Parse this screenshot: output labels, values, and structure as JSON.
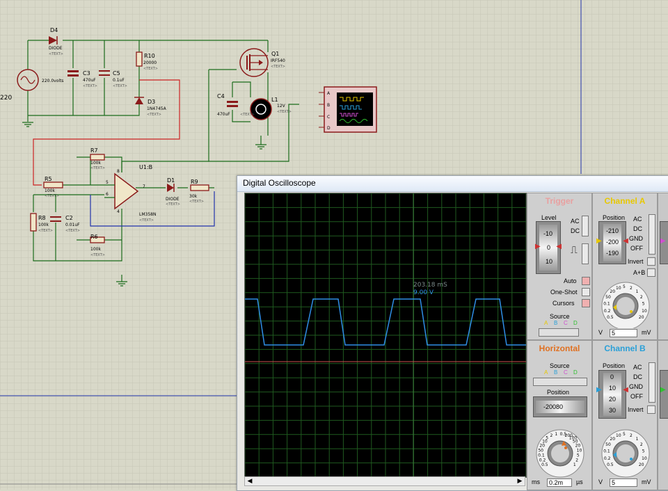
{
  "colors": {
    "background": "#d8d8c8",
    "grid": "#c6c6b6",
    "wire": "#1a6b1a",
    "component": "#8b1a1a",
    "selected_wire": "#cc2222",
    "blue_wire": "#2233aa",
    "trace_a": "#2f8ee6",
    "trace_b": "#d05050",
    "scope_grid": "#1f5a1f",
    "trigger": "#e8a0a0",
    "channel_a": "#e8c800",
    "horizontal": "#e07020",
    "channel_b": "#2aa0d8"
  },
  "schematic": {
    "components": {
      "d4": {
        "ref": "D4",
        "value": "DIODE"
      },
      "source": {
        "value": "220"
      },
      "cap_top": {
        "value": "220.0volts"
      },
      "c3": {
        "ref": "C3",
        "value": "470uF"
      },
      "c5": {
        "ref": "C5",
        "value": "0.1uF"
      },
      "r10": {
        "ref": "R10",
        "value": "20000"
      },
      "d3": {
        "ref": "D3",
        "value": "1N4745A"
      },
      "q1": {
        "ref": "Q1",
        "value": "IRF540"
      },
      "c4": {
        "ref": "C4",
        "value": "470uF"
      },
      "l1": {
        "ref": "L1",
        "value": "12V"
      },
      "r7": {
        "ref": "R7",
        "value": "100k"
      },
      "u1": {
        "ref": "U1:B",
        "value": "LM358N"
      },
      "r5": {
        "ref": "R5",
        "value": "100k"
      },
      "d1": {
        "ref": "D1",
        "value": "DIODE"
      },
      "r9": {
        "ref": "R9",
        "value": "30k"
      },
      "r8": {
        "ref": "R8",
        "value": "100k"
      },
      "c2": {
        "ref": "C2",
        "value": "0.01uF"
      },
      "r6": {
        "ref": "R6",
        "value": "100k"
      }
    },
    "text_placeholder": "<TEXT>",
    "pins": {
      "p5": "5",
      "p6": "6",
      "p7": "7",
      "p8": "8",
      "p4": "4"
    },
    "scope_channels": [
      "A",
      "B",
      "C",
      "D"
    ]
  },
  "oscilloscope": {
    "window_title": "Digital Oscilloscope",
    "cursor_time": "203.18 mS",
    "cursor_value": "9.00 V",
    "trigger": {
      "title": "Trigger",
      "level_label": "Level",
      "level_ticks": [
        "-10",
        "0",
        "10"
      ],
      "ac": "AC",
      "dc": "DC",
      "auto": "Auto",
      "one_shot": "One-Shot",
      "cursors": "Cursors",
      "source_label": "Source",
      "source_channels": [
        "A",
        "B",
        "C",
        "D"
      ]
    },
    "channel_a": {
      "title": "Channel A",
      "position_label": "Position",
      "position_ticks": [
        "-210",
        "-200",
        "-190"
      ],
      "modes": [
        "AC",
        "DC",
        "GND",
        "OFF"
      ],
      "invert": "Invert",
      "a_plus_b": "A+B",
      "dial_marks": [
        "0.5",
        "0.2",
        "0.1",
        "50",
        "20",
        "10",
        "5",
        "2",
        "1",
        "2",
        "5",
        "10",
        "20"
      ],
      "unit_left": "V",
      "value": "5",
      "unit_right": "mV"
    },
    "horizontal": {
      "title": "Horizontal",
      "source_label": "Source",
      "source_channels": [
        "A",
        "B",
        "C",
        "D"
      ],
      "position_label": "Position",
      "position_value": "-20080",
      "dial_marks": [
        "0.5",
        "0.2",
        "0.1",
        "50",
        "20",
        "10",
        "5",
        "2",
        "1",
        "0.5",
        "200",
        "100",
        "50",
        "20",
        "10",
        "5",
        "2",
        "1"
      ],
      "unit_left": "ms",
      "value": "0.2m",
      "unit_right": "µs"
    },
    "channel_b": {
      "title": "Channel B",
      "position_label": "Position",
      "position_ticks": [
        "0",
        "10",
        "20",
        "30"
      ],
      "modes": [
        "AC",
        "DC",
        "GND",
        "OFF"
      ],
      "invert": "Invert",
      "dial_marks": [
        "0.5",
        "0.2",
        "0.1",
        "50",
        "20",
        "10",
        "5",
        "2",
        "1",
        "2",
        "5",
        "10",
        "20"
      ],
      "unit_left": "V",
      "value": "5",
      "unit_right": "mV"
    }
  }
}
